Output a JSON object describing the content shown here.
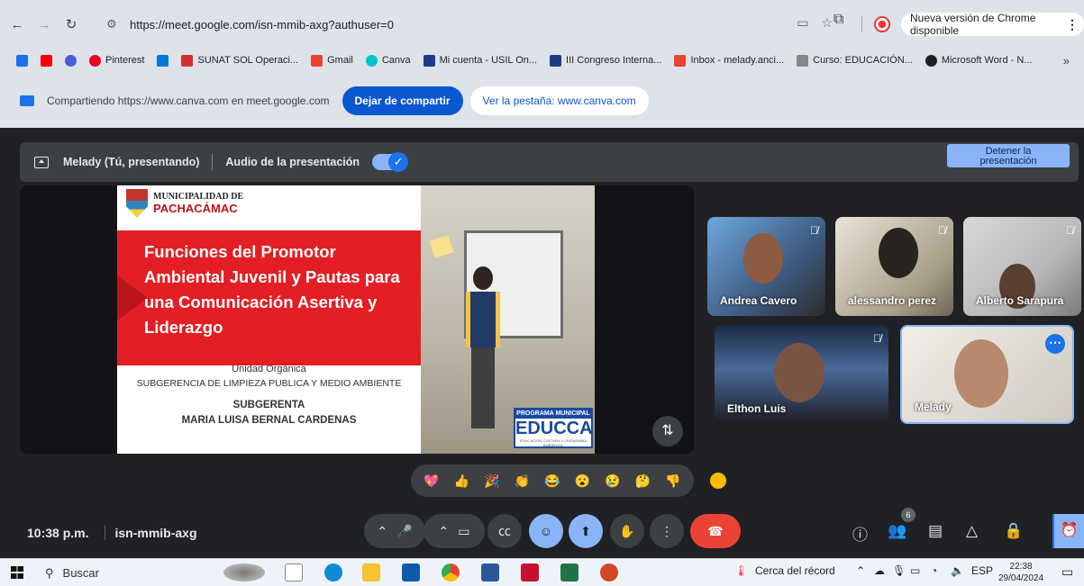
{
  "browser": {
    "url": "https://meet.google.com/isn-mmib-axg?authuser=0",
    "update_label": "Nueva versión de Chrome disponible"
  },
  "bookmarks": [
    {
      "label": "Pinterest",
      "color": "#e60023"
    },
    {
      "label": "SUNAT SOL Operaci...",
      "color": "#1565c0"
    },
    {
      "label": "Gmail",
      "color": "#ea4335"
    },
    {
      "label": "Canva",
      "color": "#00c4cc"
    },
    {
      "label": "Mi cuenta - USIL On...",
      "color": "#1e3a8a"
    },
    {
      "label": "III Congreso Interna...",
      "color": "#1e3a8a"
    },
    {
      "label": "Inbox - melady.anci...",
      "color": "#ea4335"
    },
    {
      "label": "Curso: EDUCACIÓN...",
      "color": "#777777"
    },
    {
      "label": "Microsoft Word - N...",
      "color": "#202124"
    }
  ],
  "sharebar": {
    "text": "Compartiendo https://www.canva.com en meet.google.com",
    "stop_label": "Dejar de compartir",
    "view_label": "Ver la pestaña: www.canva.com"
  },
  "presenting": {
    "name": "Melady (Tú, presentando)",
    "audio_label": "Audio de la presentación",
    "stop_label_1": "Detener la",
    "stop_label_2": "presentación"
  },
  "slide": {
    "muni_line1": "MUNICIPALIDAD DE",
    "muni_line2": "PACHACÁMAC",
    "title": "Funciones del Promotor Ambiental Juvenil y Pautas para una Comunicación Asertiva y Liderazgo",
    "unit_label": "Unidad Orgánica",
    "unit_name": "SUBGERENCIA DE LIMPIEZA PUBLICA Y MEDIO AMBIENTE",
    "role": "SUBGERENTA",
    "person": "MARIA LUISA BERNAL CARDENAS",
    "program_label": "PROGRAMA MUNICIPAL",
    "program_name": "EDUCCA",
    "program_sub": "EDUCACIÓN, CULTURA Y CIUDADANÍA AMBIENTAL"
  },
  "participants": [
    {
      "name": "Andrea Cavero",
      "muted": true
    },
    {
      "name": "alessandro perez",
      "muted": true
    },
    {
      "name": "Alberto Sarapura",
      "muted": true
    },
    {
      "name": "Elthon Luis",
      "muted": true
    },
    {
      "name": "Melady",
      "muted": false
    }
  ],
  "reactions": [
    "💖",
    "👍",
    "🎉",
    "👏",
    "😂",
    "😮",
    "😢",
    "🤔",
    "👎"
  ],
  "meeting": {
    "time": "10:38 p.m.",
    "code": "isn-mmib-axg",
    "participant_count": "6"
  },
  "taskbar": {
    "search_label": "Buscar",
    "weather": "Cerca del récord",
    "lang": "ESP",
    "time": "22:38",
    "date": "29/04/2024"
  }
}
